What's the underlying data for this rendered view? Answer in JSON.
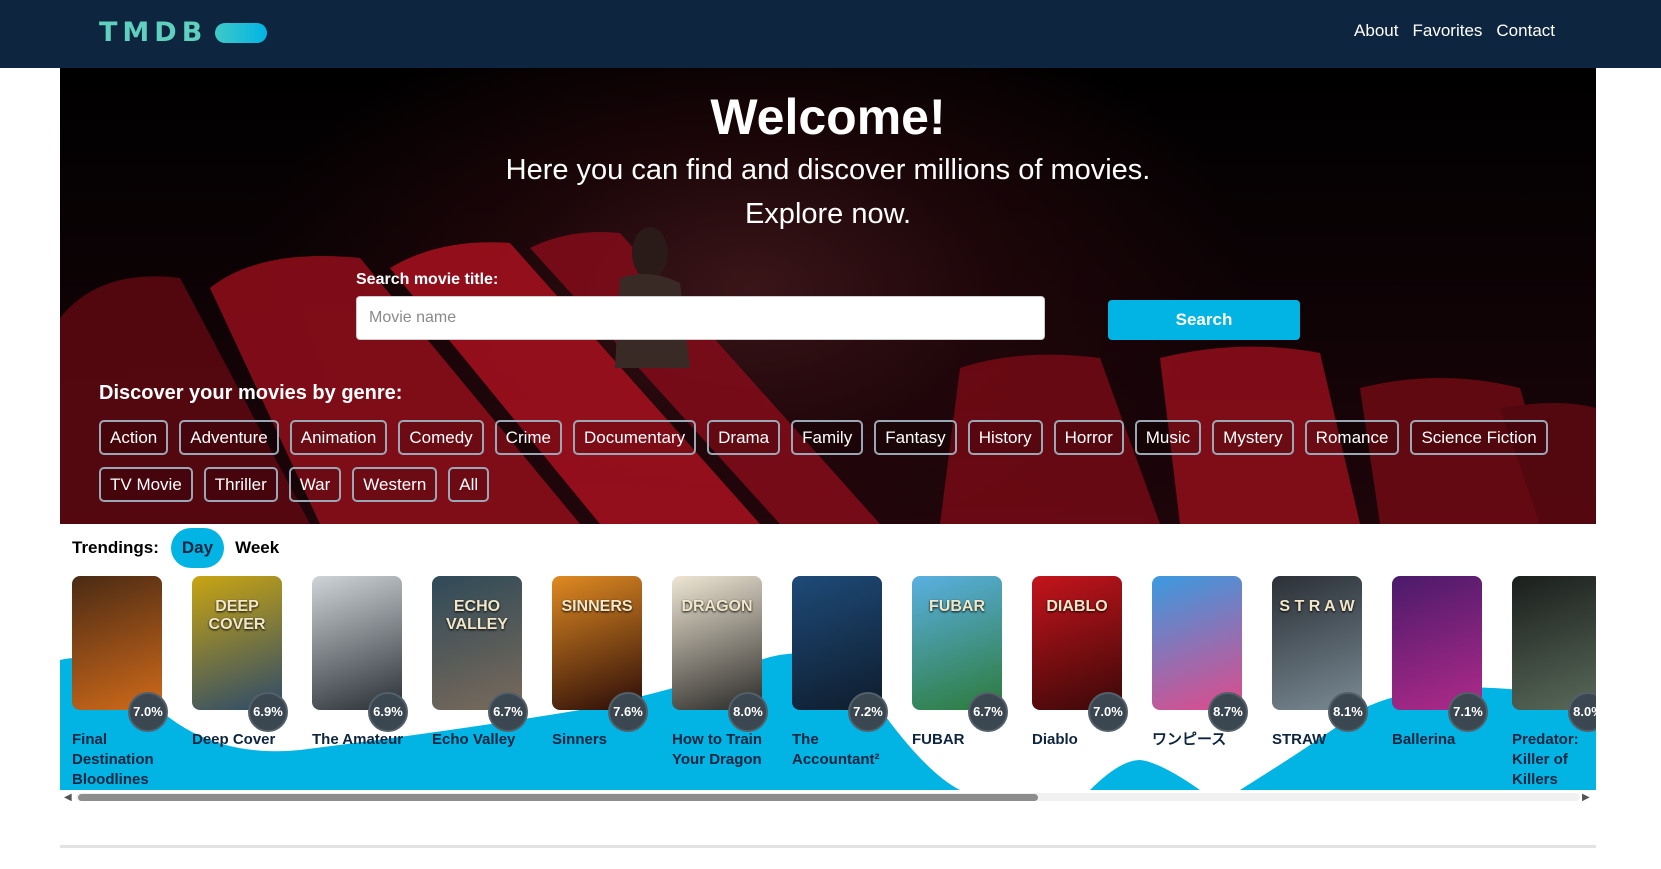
{
  "header": {
    "logo_text": "TMDB",
    "nav": [
      {
        "label": "About"
      },
      {
        "label": "Favorites"
      },
      {
        "label": "Contact"
      }
    ]
  },
  "hero": {
    "title": "Welcome!",
    "subtitle_line1": "Here you can find and discover millions of movies.",
    "subtitle_line2": "Explore now.",
    "search_label": "Search movie title:",
    "search_placeholder": "Movie name",
    "search_value": "",
    "search_button": "Search",
    "genre_title": "Discover your movies by genre:",
    "genres": [
      "Action",
      "Adventure",
      "Animation",
      "Comedy",
      "Crime",
      "Documentary",
      "Drama",
      "Family",
      "Fantasy",
      "History",
      "Horror",
      "Music",
      "Mystery",
      "Romance",
      "Science Fiction",
      "TV Movie",
      "Thriller",
      "War",
      "Western",
      "All"
    ]
  },
  "trending": {
    "label": "Trendings:",
    "tabs": [
      {
        "label": "Day",
        "active": true
      },
      {
        "label": "Week",
        "active": false
      }
    ],
    "movies": [
      {
        "title": "Final Destination Bloodlines",
        "score": "7.0%",
        "poster_text": "",
        "colors": [
          "#4a2a14",
          "#d06a1a"
        ]
      },
      {
        "title": "Deep Cover",
        "score": "6.9%",
        "poster_text": "DEEP COVER",
        "colors": [
          "#c9a512",
          "#2c4a6a"
        ]
      },
      {
        "title": "The Amateur",
        "score": "6.9%",
        "poster_text": "",
        "colors": [
          "#cfd4d8",
          "#2a2f36"
        ]
      },
      {
        "title": "Echo Valley",
        "score": "6.7%",
        "poster_text": "ECHO VALLEY",
        "colors": [
          "#2f4a58",
          "#7a6a5a"
        ]
      },
      {
        "title": "Sinners",
        "score": "7.6%",
        "poster_text": "SINNERS",
        "colors": [
          "#e08a22",
          "#2a0c08"
        ]
      },
      {
        "title": "How to Train Your Dragon",
        "score": "8.0%",
        "poster_text": "DRAGON",
        "colors": [
          "#efe6d4",
          "#2b2a28"
        ]
      },
      {
        "title": "The Accountant²",
        "score": "7.2%",
        "poster_text": "",
        "colors": [
          "#1e4a78",
          "#0e1c2c"
        ]
      },
      {
        "title": "FUBAR",
        "score": "6.7%",
        "poster_text": "FUBAR",
        "colors": [
          "#5ab0e2",
          "#2c7a3a"
        ]
      },
      {
        "title": "Diablo",
        "score": "7.0%",
        "poster_text": "DIABLO",
        "colors": [
          "#c4141c",
          "#3a0808"
        ]
      },
      {
        "title": "ワンピース",
        "score": "8.7%",
        "poster_text": "",
        "colors": [
          "#3a9ae0",
          "#e04a8a"
        ]
      },
      {
        "title": "STRAW",
        "score": "8.1%",
        "poster_text": "S T R A W",
        "colors": [
          "#2a3036",
          "#7a8a94"
        ]
      },
      {
        "title": "Ballerina",
        "score": "7.1%",
        "poster_text": "",
        "colors": [
          "#4a1a6a",
          "#b02a8a"
        ]
      },
      {
        "title": "Predator: Killer of Killers",
        "score": "8.0%",
        "poster_text": "",
        "colors": [
          "#1a1e1c",
          "#5a6a5a"
        ]
      }
    ]
  },
  "colors": {
    "navy": "#0d253f",
    "accent": "#01b4e4",
    "logo": "#5fcfc0",
    "wave": "#01b4e4"
  }
}
